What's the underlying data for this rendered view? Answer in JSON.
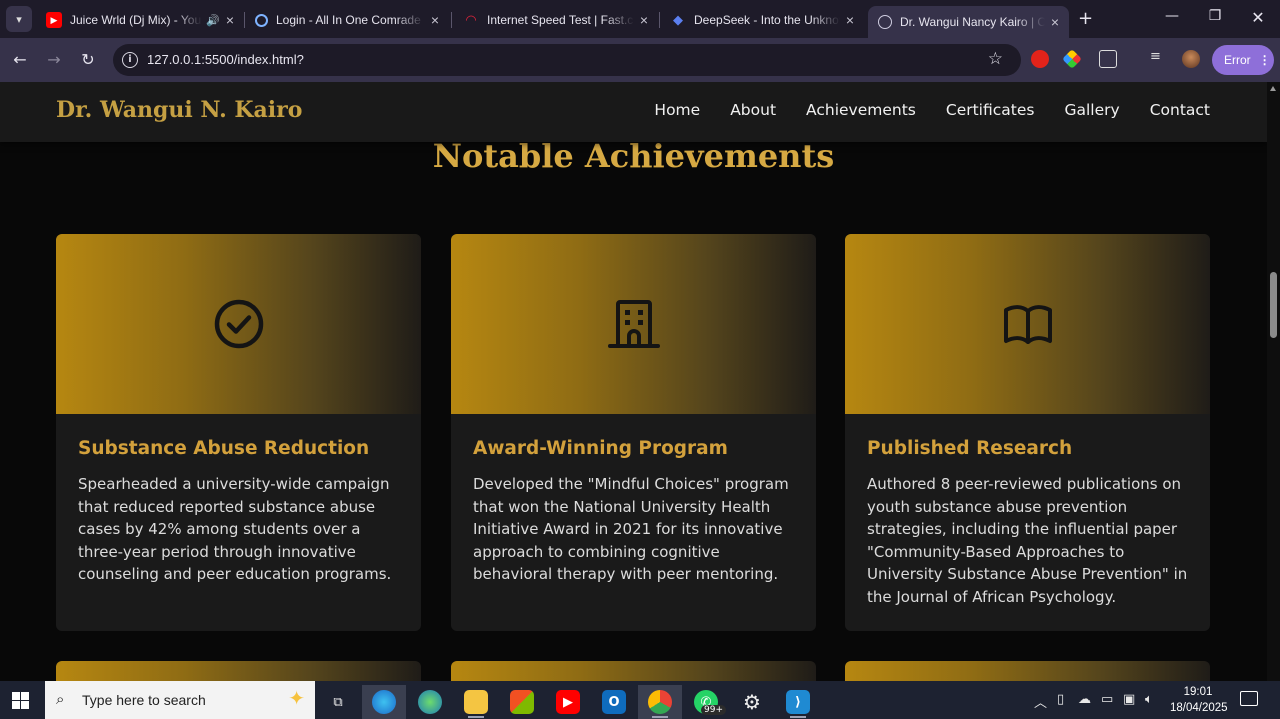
{
  "browser": {
    "tabs": [
      {
        "title": "Juice Wrld (Dj Mix) - You",
        "favicon": "youtube-icon",
        "audio": true
      },
      {
        "title": "Login - All In One Comrade",
        "favicon": "loading-icon"
      },
      {
        "title": "Internet Speed Test | Fast.com",
        "favicon": "fast-icon"
      },
      {
        "title": "DeepSeek - Into the Unknown",
        "favicon": "deepseek-icon"
      },
      {
        "title": "Dr. Wangui Nancy Kairo | Co",
        "favicon": "globe-icon",
        "active": true
      }
    ],
    "url": "127.0.0.1:5500/index.html?",
    "profile_status": "Error"
  },
  "site": {
    "brand": "Dr. Wangui N. Kairo",
    "nav": [
      "Home",
      "About",
      "Achievements",
      "Certificates",
      "Gallery",
      "Contact"
    ],
    "section_title": "Notable Achievements",
    "cards": [
      {
        "icon": "check-circle-icon",
        "title": "Substance Abuse Reduction",
        "text": "Spearheaded a university-wide campaign that reduced reported substance abuse cases by 42% among students over a three-year period through innovative counseling and peer education programs."
      },
      {
        "icon": "building-icon",
        "title": "Award-Winning Program",
        "text": "Developed the \"Mindful Choices\" program that won the National University Health Initiative Award in 2021 for its innovative approach to combining cognitive behavioral therapy with peer mentoring."
      },
      {
        "icon": "book-icon",
        "title": "Published Research",
        "text": "Authored 8 peer-reviewed publications on youth substance abuse prevention strategies, including the influential paper \"Community-Based Approaches to University Substance Abuse Prevention\" in the Journal of African Psychology."
      }
    ],
    "colors": {
      "gold": "#d6a943",
      "card_bg": "#1a1a1a",
      "page_bg": "#080808"
    }
  },
  "taskbar": {
    "search_placeholder": "Type here to search",
    "whatsapp_badge": "99+",
    "time": "19:01",
    "date": "18/04/2025"
  }
}
